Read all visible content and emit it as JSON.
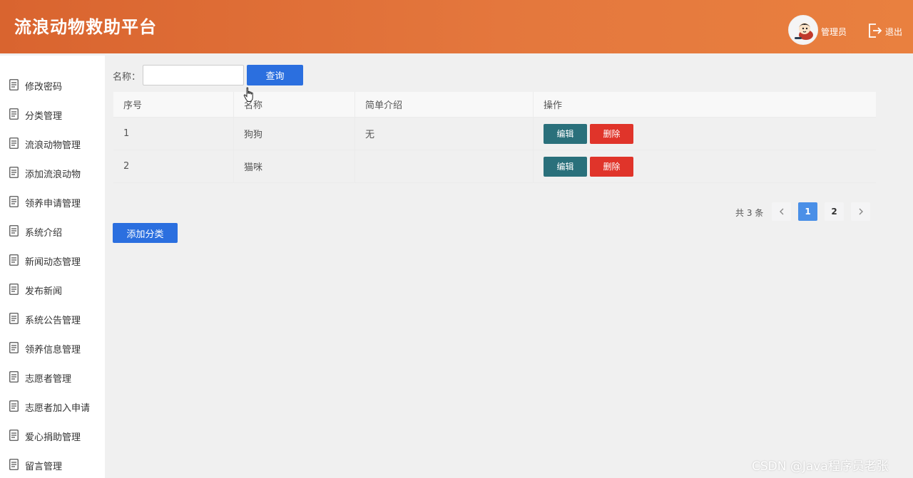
{
  "header": {
    "title": "流浪动物救助平台",
    "user_name": "管理员",
    "logout_label": "退出"
  },
  "sidebar": {
    "items": [
      {
        "label": "修改密码"
      },
      {
        "label": "分类管理"
      },
      {
        "label": "流浪动物管理"
      },
      {
        "label": "添加流浪动物"
      },
      {
        "label": "领养申请管理"
      },
      {
        "label": "系统介绍"
      },
      {
        "label": "新闻动态管理"
      },
      {
        "label": "发布新闻"
      },
      {
        "label": "系统公告管理"
      },
      {
        "label": "领养信息管理"
      },
      {
        "label": "志愿者管理"
      },
      {
        "label": "志愿者加入申请"
      },
      {
        "label": "爱心捐助管理"
      },
      {
        "label": "留言管理"
      }
    ]
  },
  "search": {
    "label": "名称：",
    "value": "",
    "placeholder": "",
    "button": "查询"
  },
  "table": {
    "headers": [
      "序号",
      "名称",
      "简单介绍",
      "操作"
    ],
    "rows": [
      {
        "index": "1",
        "name": "狗狗",
        "intro": "无",
        "edit": "编辑",
        "delete": "删除"
      },
      {
        "index": "2",
        "name": "猫咪",
        "intro": "",
        "edit": "编辑",
        "delete": "删除"
      }
    ]
  },
  "pagination": {
    "total_text": "共 3 条",
    "pages": [
      "1",
      "2"
    ],
    "current": "1",
    "prev_icon": "chevron-left-icon",
    "next_icon": "chevron-right-icon"
  },
  "actions": {
    "add_label": "添加分类"
  },
  "watermark": "CSDN @Java程序员老张",
  "colors": {
    "header_gradient_start": "#d9642f",
    "header_gradient_end": "#e9803f",
    "primary": "#2b6fdf",
    "edit": "#2a707b",
    "delete": "#e0342a",
    "page_active": "#4a8fe7"
  }
}
